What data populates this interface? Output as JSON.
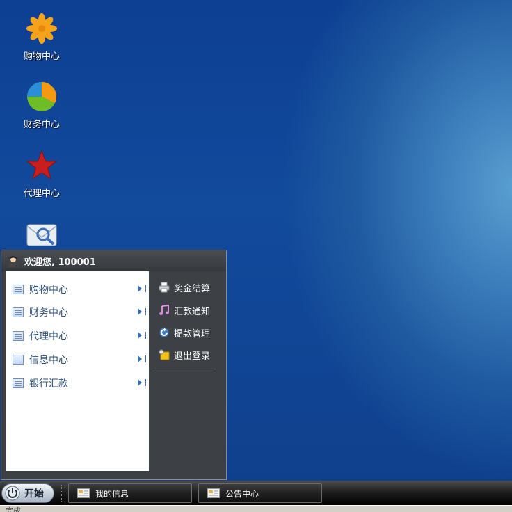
{
  "desktop": {
    "icons": [
      {
        "label": "购物中心",
        "icon": "flower-icon"
      },
      {
        "label": "财务中心",
        "icon": "pie-chart-icon"
      },
      {
        "label": "代理中心",
        "icon": "star-icon"
      },
      {
        "label": "",
        "icon": "mail-search-icon"
      }
    ]
  },
  "start_menu": {
    "welcome": "欢迎您, 100001",
    "left_items": [
      {
        "label": "购物中心"
      },
      {
        "label": "财务中心"
      },
      {
        "label": "代理中心"
      },
      {
        "label": "信息中心"
      },
      {
        "label": "银行汇款"
      }
    ],
    "right_items": [
      {
        "label": "奖金结算",
        "icon": "printer-icon"
      },
      {
        "label": "汇款通知",
        "icon": "music-note-icon"
      },
      {
        "label": "提款管理",
        "icon": "refresh-icon"
      },
      {
        "label": "退出登录",
        "icon": "logout-folder-icon"
      }
    ]
  },
  "taskbar": {
    "start_label": "开始",
    "tasks": [
      {
        "label": "我的信息",
        "icon": "window-card-icon"
      },
      {
        "label": "公告中心",
        "icon": "window-card-icon"
      }
    ]
  },
  "status": {
    "text": "完成"
  },
  "colors": {
    "desktop_blue": "#124a9c",
    "menu_dark": "#3d4145",
    "menu_link": "#2b4f7a"
  }
}
